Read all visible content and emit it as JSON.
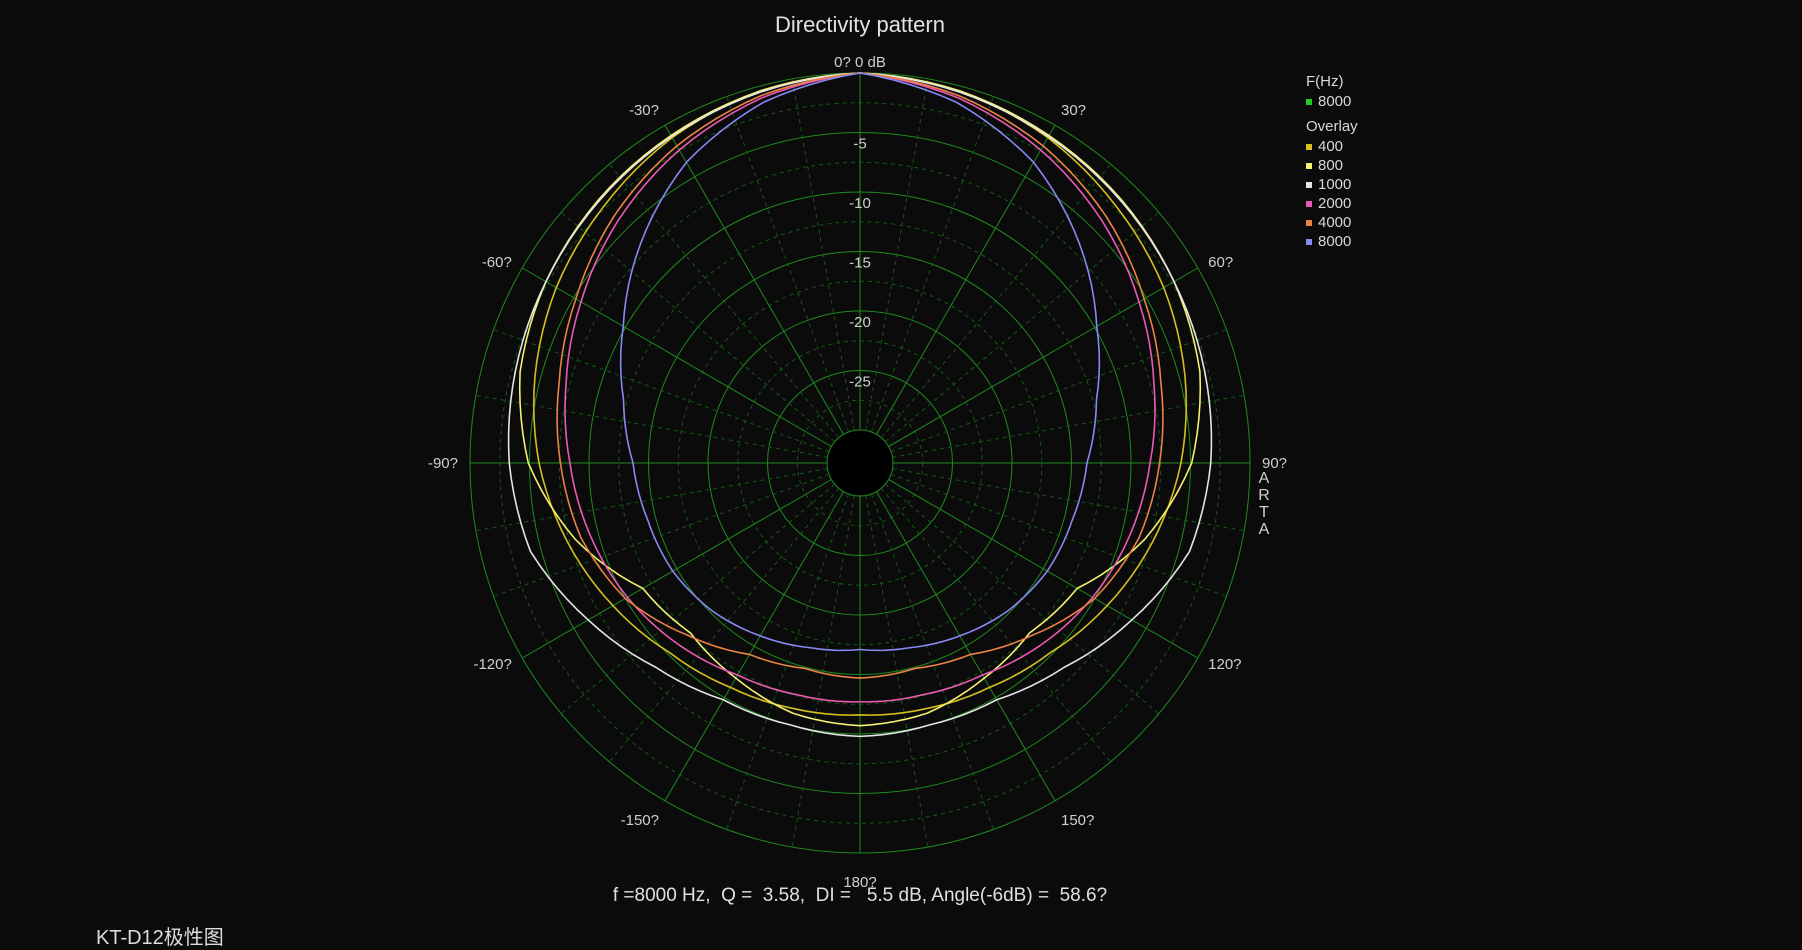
{
  "chart_data": {
    "type": "polar",
    "title": "Directivity pattern",
    "radial_unit": "dB",
    "radial_ticks": [
      "0",
      "-5",
      "-10",
      "-15",
      "-20",
      "-25"
    ],
    "radial_top_label": "0? 0 dB",
    "rlim": [
      -30,
      0
    ],
    "angle_labels": [
      {
        "angle": 30,
        "text": "30?"
      },
      {
        "angle": 60,
        "text": "60?"
      },
      {
        "angle": 90,
        "text": "90?"
      },
      {
        "angle": 120,
        "text": "120?"
      },
      {
        "angle": 150,
        "text": "150?"
      },
      {
        "angle": 180,
        "text": "180?"
      },
      {
        "angle": -150,
        "text": "-150?"
      },
      {
        "angle": -120,
        "text": "-120?"
      },
      {
        "angle": -90,
        "text": "-90?"
      },
      {
        "angle": -60,
        "text": "-60?"
      },
      {
        "angle": -30,
        "text": "-30?"
      }
    ],
    "grid": true,
    "legend": {
      "placement": "top-right",
      "header": "F(Hz)",
      "current": {
        "name": "8000",
        "color": "#22cc22"
      },
      "overlay_header": "Overlay"
    },
    "angles_deg": [
      0,
      15,
      30,
      45,
      60,
      75,
      90,
      105,
      120,
      135,
      150,
      165,
      180
    ],
    "series": [
      {
        "name": "400",
        "color": "#d6c020",
        "values": [
          0,
          -0.4,
          -1.2,
          -2.3,
          -3.3,
          -4.5,
          -5.8,
          -7.3,
          -8.8,
          -10.2,
          -11.0,
          -11.4,
          -11.6
        ]
      },
      {
        "name": "800",
        "color": "#f4f070",
        "values": [
          0,
          -0.4,
          -1.0,
          -1.6,
          -2.3,
          -3.2,
          -4.9,
          -8.0,
          -11.7,
          -12.6,
          -11.9,
          -11.0,
          -10.7
        ]
      },
      {
        "name": "1000",
        "color": "#e4e4e4",
        "values": [
          0,
          -0.5,
          -1.1,
          -1.7,
          -2.3,
          -2.8,
          -3.3,
          -4.1,
          -6.4,
          -8.5,
          -9.8,
          -10.0,
          -9.8
        ]
      },
      {
        "name": "2000",
        "color": "#ea5ab4",
        "values": [
          0,
          -1.0,
          -2.4,
          -4.0,
          -5.7,
          -7.2,
          -8.4,
          -9.3,
          -10.2,
          -11.2,
          -12.2,
          -12.6,
          -12.7
        ]
      },
      {
        "name": "4000",
        "color": "#ea8246",
        "values": [
          0,
          -0.8,
          -2.0,
          -3.5,
          -5.2,
          -6.6,
          -7.6,
          -8.5,
          -10.0,
          -12.3,
          -14.2,
          -14.9,
          -14.7
        ]
      },
      {
        "name": "8000",
        "color": "#8888f4",
        "values": [
          0,
          -1.4,
          -3.6,
          -6.7,
          -9.8,
          -12.2,
          -13.7,
          -14.3,
          -14.6,
          -15.2,
          -16.0,
          -16.7,
          -17.1
        ]
      }
    ]
  },
  "footer": {
    "stats": "f =8000 Hz,  Q =  3.58,  DI =   5.5 dB, Angle(-6dB) =  58.6?",
    "caption": "KT-D12极性图"
  },
  "brand": [
    "A",
    "R",
    "T",
    "A"
  ],
  "colors": {
    "grid": "#1f8a1f",
    "grid_minor": "#155a15",
    "background": "#0b0b0b"
  }
}
